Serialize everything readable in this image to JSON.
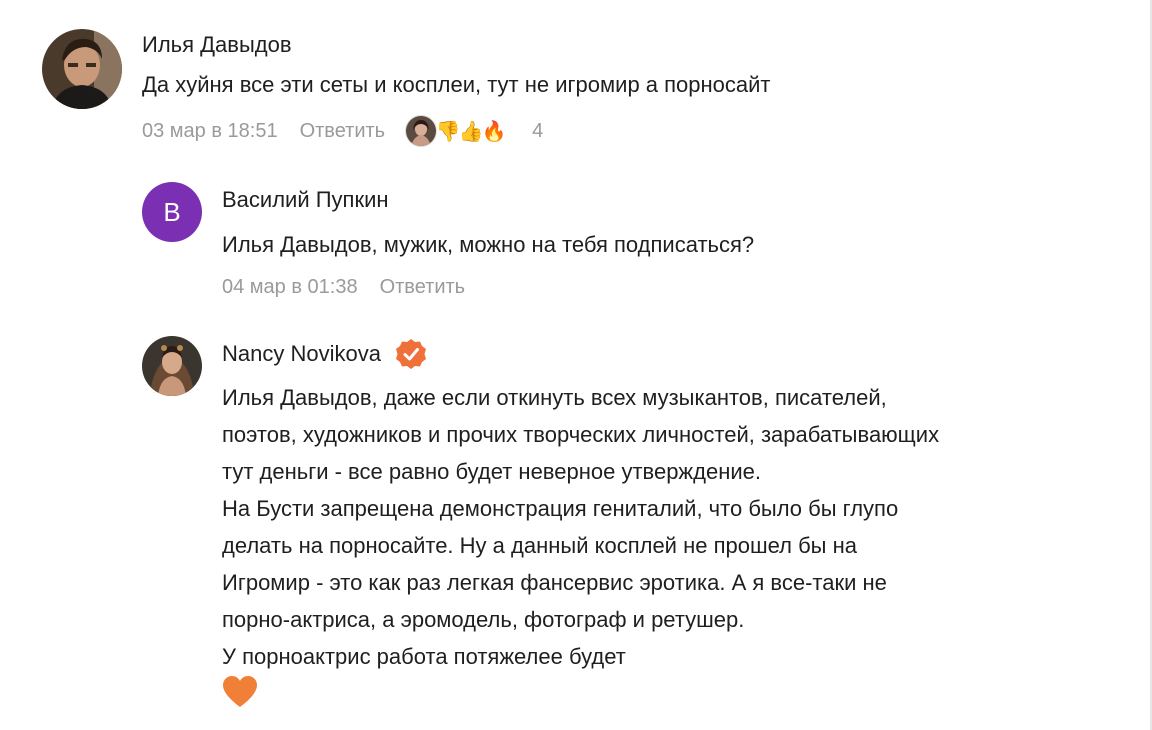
{
  "comments": [
    {
      "author": "Илья Давыдов",
      "text": "Да хуйня все эти сеты и косплеи, тут не игромир а порносайт",
      "time": "03 мар в 18:51",
      "reply_label": "Ответить",
      "reactions": [
        "avatar",
        "thumbs-down",
        "thumbs-up",
        "fire"
      ],
      "reaction_count": "4"
    },
    {
      "author": "Василий Пупкин",
      "avatar_letter": "В",
      "avatar_color": "#7b2fb3",
      "text": "Илья Давыдов, мужик, можно на тебя подписаться?",
      "time": "04 мар в 01:38",
      "reply_label": "Ответить"
    },
    {
      "author": "Nancy Novikova",
      "verified": true,
      "badge_color": "#f0703a",
      "lines": [
        "Илья Давыдов, даже если откинуть всех музыкантов, писателей,",
        "поэтов, художников и прочих творческих личностей, зарабатывающих",
        "тут деньги - все равно будет неверное утверждение.",
        "На Бусти запрещена демонстрация гениталий, что было бы глупо",
        "делать на порносайте. Ну а данный косплей не прошел бы на",
        "Игромир - это как раз легкая фансервис эротика. А я все-таки не",
        "порно-актриса, а эромодель, фотограф и ретушер.",
        "У порноактрис работа потяжелее будет"
      ],
      "emoji": "heart"
    }
  ]
}
